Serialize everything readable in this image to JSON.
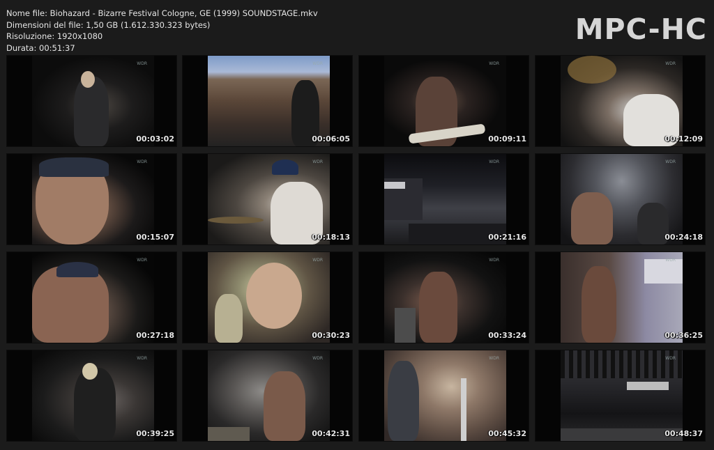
{
  "header": {
    "file_name": "Nome file: Biohazard - Bizarre Festival Cologne, GE (1999) SOUNDSTAGE.mkv",
    "file_size": "Dimensioni del file: 1,50 GB (1.612.330.323 bytes)",
    "resolution": "Risoluzione: 1920x1080",
    "duration": "Durata: 00:51:37"
  },
  "logo": "MPC-HC",
  "thumbnails": [
    {
      "time": "00:03:02",
      "badge": "WDR"
    },
    {
      "time": "00:06:05",
      "badge": "WDR"
    },
    {
      "time": "00:09:11",
      "badge": "WDR"
    },
    {
      "time": "00:12:09",
      "badge": "WDR"
    },
    {
      "time": "00:15:07",
      "badge": "WDR"
    },
    {
      "time": "00:18:13",
      "badge": "WDR"
    },
    {
      "time": "00:21:16",
      "badge": "WDR"
    },
    {
      "time": "00:24:18",
      "badge": "WDR"
    },
    {
      "time": "00:27:18",
      "badge": "WDR"
    },
    {
      "time": "00:30:23",
      "badge": "WDR"
    },
    {
      "time": "00:33:24",
      "badge": "WDR"
    },
    {
      "time": "00:36:25",
      "badge": "WDR"
    },
    {
      "time": "00:39:25",
      "badge": "WDR"
    },
    {
      "time": "00:42:31",
      "badge": "WDR"
    },
    {
      "time": "00:45:32",
      "badge": "WDR"
    },
    {
      "time": "00:48:37",
      "badge": "WDR"
    }
  ]
}
